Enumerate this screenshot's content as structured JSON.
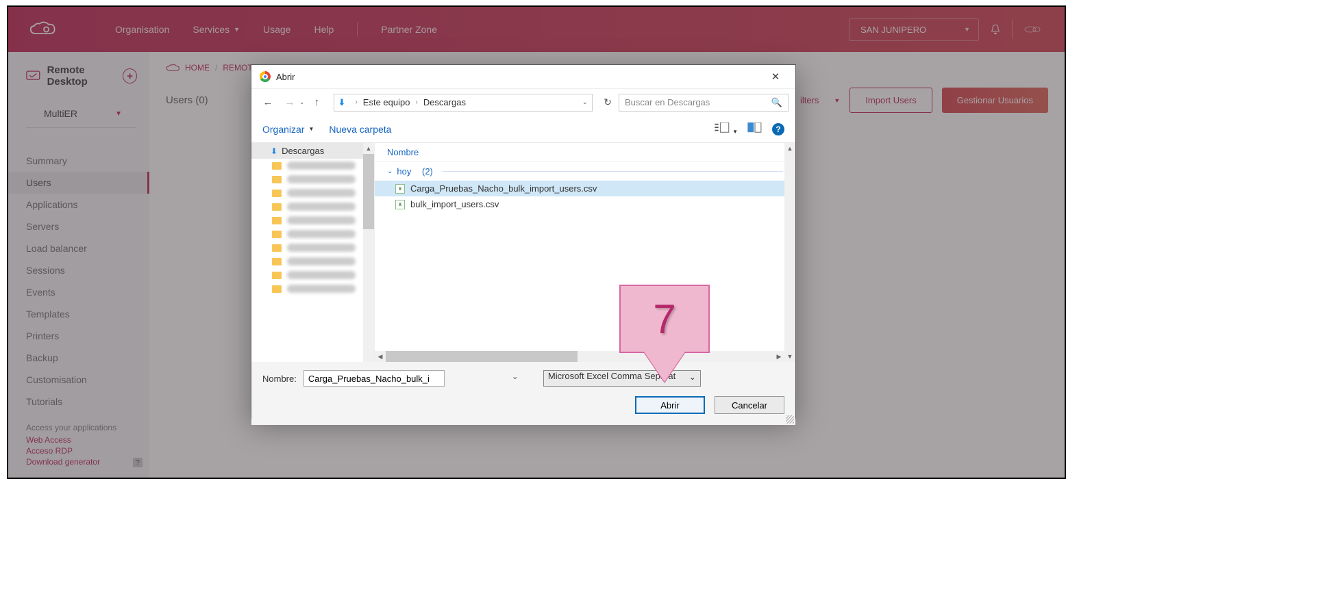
{
  "header": {
    "nav": {
      "organisation": "Organisation",
      "services": "Services",
      "usage": "Usage",
      "help": "Help",
      "partner": "Partner Zone"
    },
    "org_selected": "SAN JUNIPERO"
  },
  "sidebar": {
    "title": "Remote Desktop",
    "filter": "MultiER",
    "items": [
      "Summary",
      "Users",
      "Applications",
      "Servers",
      "Load balancer",
      "Sessions",
      "Events",
      "Templates",
      "Printers",
      "Backup",
      "Customisation",
      "Tutorials"
    ],
    "active_index": 1,
    "bottom": {
      "heading": "Access your applications",
      "links": [
        "Web Access",
        "Acceso RDP",
        "Download generator"
      ]
    }
  },
  "main": {
    "breadcrumb": {
      "home": "HOME",
      "remote": "REMOTE"
    },
    "users_label": "Users (0)",
    "filters_label": "ilters",
    "btn_import": "Import Users",
    "btn_manage": "Gestionar Usuarios"
  },
  "dialog": {
    "title": "Abrir",
    "path": {
      "root": "Este equipo",
      "folder": "Descargas"
    },
    "search_placeholder": "Buscar en Descargas",
    "organize": "Organizar",
    "new_folder": "Nueva carpeta",
    "tree_selected": "Descargas",
    "column_name": "Nombre",
    "group": {
      "label": "hoy",
      "count": "(2)"
    },
    "files": [
      {
        "name": "Carga_Pruebas_Nacho_bulk_import_users.csv",
        "selected": true
      },
      {
        "name": "bulk_import_users.csv",
        "selected": false
      }
    ],
    "name_label": "Nombre:",
    "name_value": "Carga_Pruebas_Nacho_bulk_import_users.csv",
    "type_filter": "Microsoft Excel Comma Separat",
    "btn_open": "Abrir",
    "btn_cancel": "Cancelar"
  },
  "callout": {
    "number": "7"
  }
}
